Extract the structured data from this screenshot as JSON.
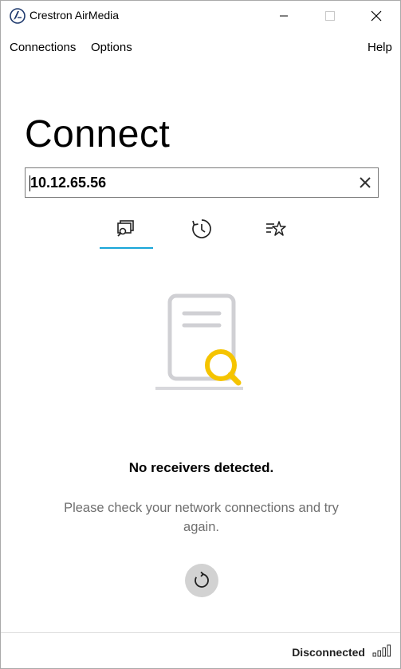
{
  "window": {
    "title": "Crestron AirMedia"
  },
  "menu": {
    "connections": "Connections",
    "options": "Options",
    "help": "Help"
  },
  "main": {
    "heading": "Connect",
    "address_value": "10.12.65.56",
    "tabs": [
      {
        "name": "discover",
        "icon": "discover-receivers-icon",
        "active": true
      },
      {
        "name": "recent",
        "icon": "history-icon",
        "active": false
      },
      {
        "name": "favorites",
        "icon": "favorites-list-icon",
        "active": false
      }
    ],
    "empty_title": "No receivers detected.",
    "empty_description": "Please check your network connections and try again."
  },
  "status": {
    "text": "Disconnected",
    "signal_icon": "signal-bars-icon"
  },
  "colors": {
    "accent": "#1aa6d8",
    "search_highlight": "#f5c400",
    "illustration_gray": "#d0d0d4",
    "refresh_bg": "#d2d2d2"
  }
}
